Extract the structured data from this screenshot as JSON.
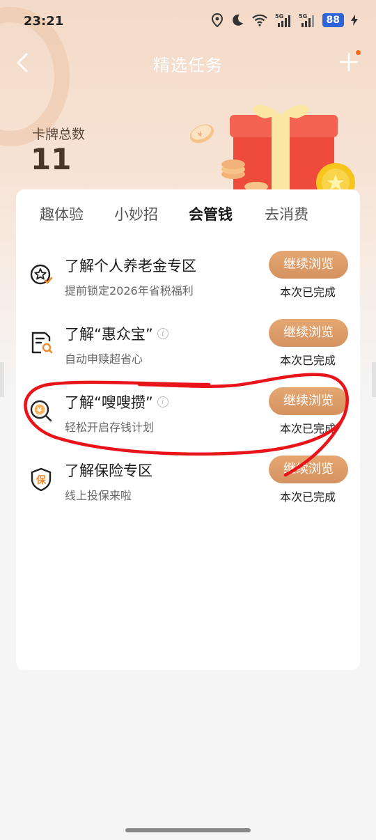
{
  "status_bar": {
    "time": "23:21",
    "battery": "88",
    "signal1": "5G",
    "signal2": "5G",
    "icons": [
      "location-icon",
      "moon-icon",
      "wifi-icon",
      "signal-5g-icon",
      "signal-5g-icon",
      "battery-icon",
      "charging-icon"
    ]
  },
  "nav": {
    "title": "精选任务",
    "back_icon": "chevron-left-icon",
    "plus_icon": "plus-icon"
  },
  "summary": {
    "label": "卡牌总数",
    "count": "11"
  },
  "tabs": [
    {
      "label": "趣体验",
      "active": false
    },
    {
      "label": "小妙招",
      "active": false
    },
    {
      "label": "会管钱",
      "active": true
    },
    {
      "label": "去消费",
      "active": false
    }
  ],
  "tasks": [
    {
      "icon": "star-badge-icon",
      "title": "了解个人养老金专区",
      "has_info": false,
      "subtitle": "提前锁定2026年省税福利",
      "button": "继续浏览",
      "status": "本次已完成"
    },
    {
      "icon": "document-search-icon",
      "title": "了解“惠众宝”",
      "has_info": true,
      "subtitle": "自动申赎超省心",
      "button": "继续浏览",
      "status": "本次已完成"
    },
    {
      "icon": "yuan-search-icon",
      "title": "了解“嗖嗖攒”",
      "has_info": true,
      "subtitle": "轻松开启存钱计划",
      "button": "继续浏览",
      "status": "本次已完成"
    },
    {
      "icon": "insurance-shield-icon",
      "title": "了解保险专区",
      "has_info": false,
      "subtitle": "线上投保来啦",
      "button": "继续浏览",
      "status": "本次已完成"
    }
  ],
  "icon_glyphs": {
    "insurance": "保",
    "yuan": "¥"
  },
  "colors": {
    "accent": "#d99a66",
    "hero_bg": "#f4dac8",
    "annotation": "#e8141a"
  }
}
